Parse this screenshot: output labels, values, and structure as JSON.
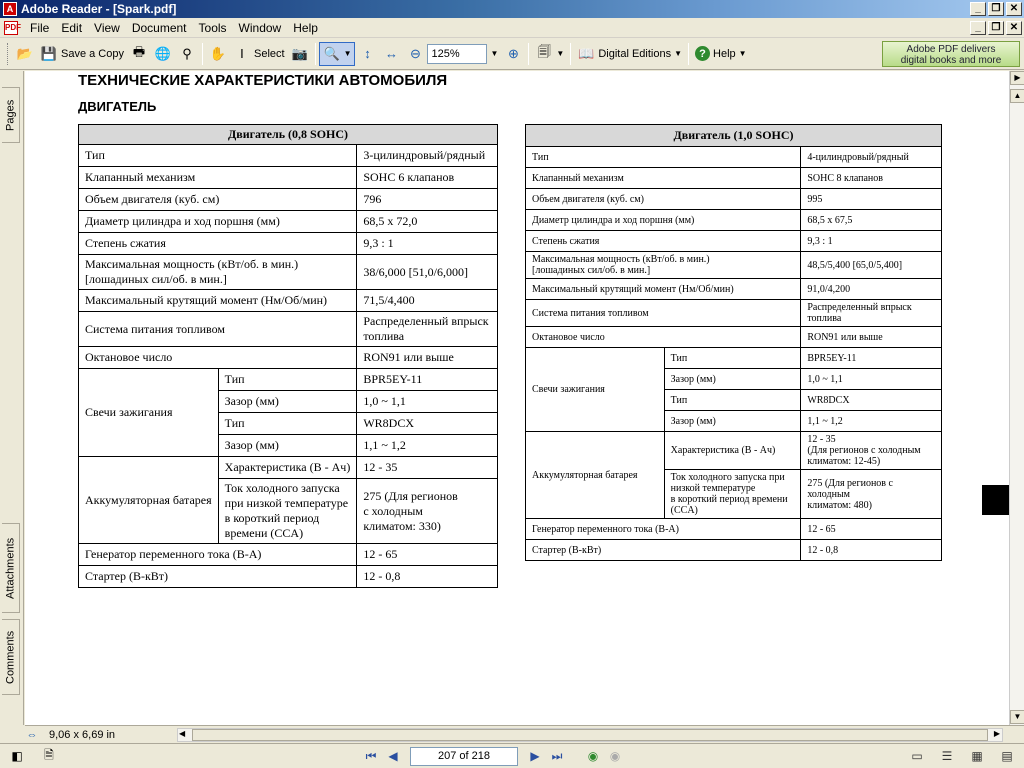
{
  "window": {
    "title": "Adobe Reader - [Spark.pdf]"
  },
  "menu": [
    "File",
    "Edit",
    "View",
    "Document",
    "Tools",
    "Window",
    "Help"
  ],
  "toolbar": {
    "save_copy": "Save a Copy",
    "select": "Select",
    "zoom_value": "125%",
    "digital_editions": "Digital Editions",
    "help": "Help",
    "ad_line1": "Adobe PDF delivers",
    "ad_line2": "digital books and more"
  },
  "navtabs": {
    "pages": "Pages",
    "attachments": "Attachments",
    "comments": "Comments"
  },
  "document": {
    "heading1": "ТЕХНИЧЕСКИЕ ХАРАКТЕРИСТИКИ АВТОМОБИЛЯ",
    "heading2": "ДВИГАТЕЛЬ",
    "table1": {
      "header": "Двигатель (0,8 SOHC)",
      "r_type_l": "Тип",
      "r_type_v": "3-цилиндровый/рядный",
      "r_valve_l": "Клапанный механизм",
      "r_valve_v": "SOHC 6 клапанов",
      "r_vol_l": "Объем двигателя (куб. см)",
      "r_vol_v": "796",
      "r_bore_l": "Диаметр цилиндра и ход поршня (мм)",
      "r_bore_v": "68,5 x 72,0",
      "r_comp_l": "Степень сжатия",
      "r_comp_v": "9,3 : 1",
      "r_pow_l1": "Максимальная мощность (кВт/об. в мин.)",
      "r_pow_l2": "[лошадиных сил/об. в мин.]",
      "r_pow_v": "38/6,000 [51,0/6,000]",
      "r_torq_l": "Максимальный крутящий момент (Нм/Об/мин)",
      "r_torq_v": "71,5/4,400",
      "r_fuel_l": "Система питания топливом",
      "r_fuel_v1": "Распределенный впрыск",
      "r_fuel_v2": "топлива",
      "r_oct_l": "Октановое число",
      "r_oct_v": "RON91 или выше",
      "r_spark_l": "Свечи зажигания",
      "r_sp1_l": "Тип",
      "r_sp1_v": "BPR5EY-11",
      "r_sp2_l": "Зазор (мм)",
      "r_sp2_v": "1,0 ~ 1,1",
      "r_sp3_l": "Тип",
      "r_sp3_v": "WR8DCX",
      "r_sp4_l": "Зазор (мм)",
      "r_sp4_v": "1,1 ~ 1,2",
      "r_bat_l": "Аккумуляторная батарея",
      "r_bat1_l": "Характеристика (В - Ач)",
      "r_bat1_v": "12 - 35",
      "r_bat2_l1": "Ток холодного запуска",
      "r_bat2_l2": "при низкой температуре",
      "r_bat2_l3": "в короткий период",
      "r_bat2_l4": "времени (CCA)",
      "r_bat2_v1": "275 (Для регионов",
      "r_bat2_v2": "с холодным",
      "r_bat2_v3": "климатом: 330)",
      "r_gen_l": "Генератор переменного тока (В-А)",
      "r_gen_v": "12 - 65",
      "r_start_l": "Стартер (В-кВт)",
      "r_start_v": "12 - 0,8"
    },
    "table2": {
      "header": "Двигатель (1,0 SOHC)",
      "r_type_l": "Тип",
      "r_type_v": "4-цилиндровый/рядный",
      "r_valve_l": "Клапанный механизм",
      "r_valve_v": "SOHC 8 клапанов",
      "r_vol_l": "Объем двигателя (куб. см)",
      "r_vol_v": "995",
      "r_bore_l": "Диаметр цилиндра и ход поршня (мм)",
      "r_bore_v": "68,5 x 67,5",
      "r_comp_l": "Степень сжатия",
      "r_comp_v": "9,3 : 1",
      "r_pow_l1": "Максимальная мощность (кВт/об. в мин.)",
      "r_pow_l2": "[лошадиных сил/об. в мин.]",
      "r_pow_v": "48,5/5,400 [65,0/5,400]",
      "r_torq_l": "Максимальный крутящий момент (Нм/Об/мин)",
      "r_torq_v": "91,0/4,200",
      "r_fuel_l": "Система питания топливом",
      "r_fuel_v1": "Распределенный впрыск",
      "r_fuel_v2": "топлива",
      "r_oct_l": "Октановое число",
      "r_oct_v": "RON91 или выше",
      "r_spark_l": "Свечи зажигания",
      "r_sp1_l": "Тип",
      "r_sp1_v": "BPR5EY-11",
      "r_sp2_l": "Зазор (мм)",
      "r_sp2_v": "1,0 ~ 1,1",
      "r_sp3_l": "Тип",
      "r_sp3_v": "WR8DCX",
      "r_sp4_l": "Зазор (мм)",
      "r_sp4_v": "1,1 ~ 1,2",
      "r_bat_l": "Аккумуляторная батарея",
      "r_bat1_l": "Характеристика (В - Ач)",
      "r_bat1_v1": "12 - 35",
      "r_bat1_v2": "(Для регионов с холодным",
      "r_bat1_v3": "климатом: 12-45)",
      "r_bat2_l1": "Ток холодного запуска при",
      "r_bat2_l2": "низкой температуре",
      "r_bat2_l3": "в короткий период времени",
      "r_bat2_l4": "(CCA)",
      "r_bat2_v1": "275 (Для регионов с холодным",
      "r_bat2_v2": "климатом: 480)",
      "r_gen_l": "Генератор переменного тока (В-А)",
      "r_gen_v": "12 - 65",
      "r_start_l": "Стартер (В-кВт)",
      "r_start_v": "12 - 0,8"
    }
  },
  "status": {
    "page_size": "9,06 x 6,69 in",
    "page_indicator": "207 of 218"
  }
}
